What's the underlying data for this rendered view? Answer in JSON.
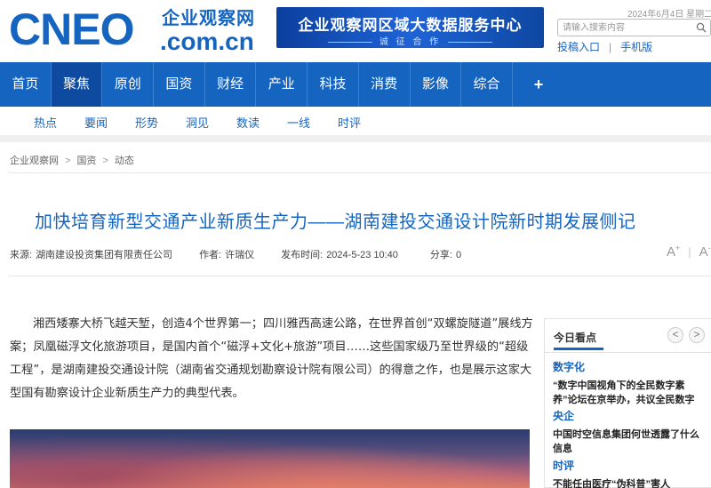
{
  "header": {
    "logo_big": "CNEO",
    "logo_cn": "企业观察网",
    "logo_domain": ".com.cn",
    "banner_title": "企业观察网区域大数据服务中心",
    "banner_sub": "诚 征 合 作",
    "date": "2024年6月4日 星期二",
    "search_placeholder": "请输入搜索内容",
    "link_submit": "投稿入口",
    "link_mobile": "手机版"
  },
  "nav": {
    "items": [
      "首页",
      "聚焦",
      "原创",
      "国资",
      "财经",
      "产业",
      "科技",
      "消费",
      "影像",
      "综合",
      "+"
    ],
    "active_index": 1
  },
  "subnav": {
    "items": [
      "热点",
      "要闻",
      "形势",
      "洞见",
      "数读",
      "一线",
      "时评"
    ]
  },
  "breadcrumb": {
    "items": [
      "企业观察网",
      "国资",
      "动态"
    ],
    "arrow": ">"
  },
  "article": {
    "title": "加快培育新型交通产业新质生产力——湖南建投交通设计院新时期发展侧记",
    "source_label": "来源:",
    "source": "湖南建设投资集团有限责任公司",
    "author_label": "作者:",
    "author": "许瑞仪",
    "time_label": "发布时间:",
    "time": "2024-5-23 10:40",
    "share_label": "分享:",
    "share_count": "0",
    "font_large": "A",
    "font_small": "A",
    "font_plus": "+",
    "font_minus": "-",
    "paragraph": "湘西矮寨大桥飞越天堑，创造4个世界第一；四川雅西高速公路，在世界首创“双螺旋隧道”展线方案；凤凰磁浮文化旅游项目，是国内首个“磁浮+文化+旅游”项目……这些国家级乃至世界级的“超级工程”，是湖南建投交通设计院（湖南省交通规划勘察设计院有限公司）的得意之作，也是展示这家大型国有勘察设计企业新质生产力的典型代表。"
  },
  "sidebar": {
    "title": "今日看点",
    "prev": "<",
    "next": ">",
    "blocks": [
      {
        "tag": "数字化",
        "text": "“数字中国视角下的全民数字素养”论坛在京举办，共议全民数字"
      },
      {
        "tag": "央企",
        "text": "中国时空信息集团何世透露了什么信息"
      },
      {
        "tag": "时评",
        "text": "不能任由医疗“伪科普”害人"
      }
    ]
  },
  "colors": {
    "brand_blue": "#1565c0",
    "nav_active": "#0d4aa0"
  }
}
